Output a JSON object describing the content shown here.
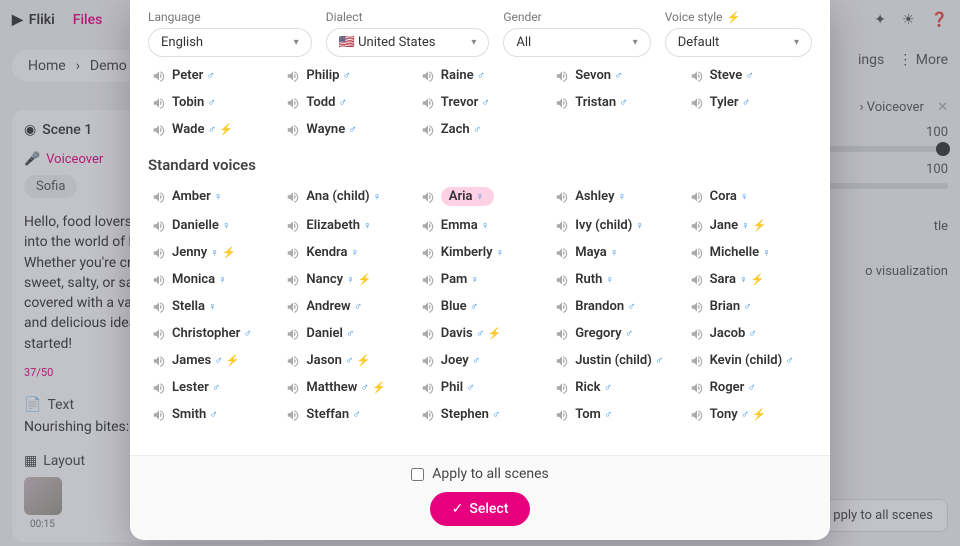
{
  "topbar": {
    "brand": "Fliki",
    "files": "Files"
  },
  "breadcrumb": {
    "home": "Home",
    "demo": "Demo"
  },
  "toolbar": {
    "settings_suffix": "ings",
    "more": "More"
  },
  "scene": {
    "scene_label": "Scene 1",
    "voiceover_label": "Voiceover",
    "voice_name": "Sofia",
    "paragraph": "Hello, food lovers! Today, we're diving into the world of healthy snacking. Whether you're craving something sweet, salty, or savory, we've got you covered with a variety of nutritious and delicious ideas. So, let's get started!",
    "counter": "37/50",
    "text_label": "Text",
    "text_value": "Nourishing bites:",
    "layout_label": "Layout",
    "thumb_time": "00:15"
  },
  "right": {
    "voiceover_tab": "Voiceover",
    "val1": "100",
    "val2": "100",
    "subtitle_suffix": "tle",
    "viz_suffix": "o visualization",
    "apply_suffix": "pply to all scenes"
  },
  "modal": {
    "labels": {
      "language": "Language",
      "dialect": "Dialect",
      "gender": "Gender",
      "style": "Voice style"
    },
    "values": {
      "language": "English",
      "dialect": "🇺🇸 United States",
      "gender": "All",
      "style": "Default"
    },
    "section_top": [
      {
        "n": "Peter",
        "g": "m"
      },
      {
        "n": "Philip",
        "g": "m"
      },
      {
        "n": "Raine",
        "g": "m"
      },
      {
        "n": "Sevon",
        "g": "m"
      },
      {
        "n": "Steve",
        "g": "m"
      },
      {
        "n": "Tobin",
        "g": "m"
      },
      {
        "n": "Todd",
        "g": "m"
      },
      {
        "n": "Trevor",
        "g": "m"
      },
      {
        "n": "Tristan",
        "g": "m"
      },
      {
        "n": "Tyler",
        "g": "m"
      },
      {
        "n": "Wade",
        "g": "m",
        "b": true
      },
      {
        "n": "Wayne",
        "g": "m"
      },
      {
        "n": "Zach",
        "g": "m"
      }
    ],
    "standard_label": "Standard voices",
    "standard": [
      {
        "n": "Amber",
        "g": "f"
      },
      {
        "n": "Ana (child)",
        "g": "f"
      },
      {
        "n": "Aria",
        "g": "f",
        "sel": true
      },
      {
        "n": "Ashley",
        "g": "f"
      },
      {
        "n": "Cora",
        "g": "f"
      },
      {
        "n": "Danielle",
        "g": "f"
      },
      {
        "n": "Elizabeth",
        "g": "f"
      },
      {
        "n": "Emma",
        "g": "f"
      },
      {
        "n": "Ivy (child)",
        "g": "f"
      },
      {
        "n": "Jane",
        "g": "f",
        "b": true
      },
      {
        "n": "Jenny",
        "g": "f",
        "b": true
      },
      {
        "n": "Kendra",
        "g": "f"
      },
      {
        "n": "Kimberly",
        "g": "f"
      },
      {
        "n": "Maya",
        "g": "f"
      },
      {
        "n": "Michelle",
        "g": "f"
      },
      {
        "n": "Monica",
        "g": "f"
      },
      {
        "n": "Nancy",
        "g": "f",
        "b": true
      },
      {
        "n": "Pam",
        "g": "f"
      },
      {
        "n": "Ruth",
        "g": "f"
      },
      {
        "n": "Sara",
        "g": "f",
        "b": true
      },
      {
        "n": "Stella",
        "g": "f"
      },
      {
        "n": "Andrew",
        "g": "m"
      },
      {
        "n": "Blue",
        "g": "m"
      },
      {
        "n": "Brandon",
        "g": "m"
      },
      {
        "n": "Brian",
        "g": "m"
      },
      {
        "n": "Christopher",
        "g": "m"
      },
      {
        "n": "Daniel",
        "g": "m"
      },
      {
        "n": "Davis",
        "g": "m",
        "b": true
      },
      {
        "n": "Gregory",
        "g": "m"
      },
      {
        "n": "Jacob",
        "g": "m"
      },
      {
        "n": "James",
        "g": "m",
        "b": true
      },
      {
        "n": "Jason",
        "g": "m",
        "b": true
      },
      {
        "n": "Joey",
        "g": "m"
      },
      {
        "n": "Justin (child)",
        "g": "m"
      },
      {
        "n": "Kevin (child)",
        "g": "m"
      },
      {
        "n": "Lester",
        "g": "m"
      },
      {
        "n": "Matthew",
        "g": "m",
        "b": true
      },
      {
        "n": "Phil",
        "g": "m"
      },
      {
        "n": "Rick",
        "g": "m"
      },
      {
        "n": "Roger",
        "g": "m"
      },
      {
        "n": "Smith",
        "g": "m"
      },
      {
        "n": "Steffan",
        "g": "m"
      },
      {
        "n": "Stephen",
        "g": "m"
      },
      {
        "n": "Tom",
        "g": "m"
      },
      {
        "n": "Tony",
        "g": "m",
        "b": true
      }
    ],
    "apply_all": "Apply to all scenes",
    "select": "Select"
  }
}
